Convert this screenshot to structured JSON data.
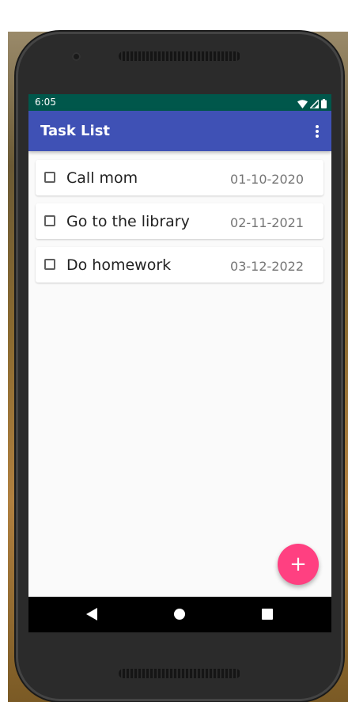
{
  "status_bar": {
    "time": "6:05",
    "icons": [
      "wifi-icon",
      "signal-icon",
      "battery-icon"
    ]
  },
  "app_bar": {
    "title": "Task List",
    "menu_icon": "more-vert-icon"
  },
  "tasks": [
    {
      "title": "Call mom",
      "date": "01-10-2020",
      "checked": false
    },
    {
      "title": "Go to the library",
      "date": "02-11-2021",
      "checked": false
    },
    {
      "title": "Do homework",
      "date": "03-12-2022",
      "checked": false
    }
  ],
  "fab": {
    "label": "+",
    "icon": "add-icon"
  },
  "nav_bar": {
    "buttons": [
      "back-icon",
      "home-icon",
      "recents-icon"
    ]
  },
  "colors": {
    "status_bar": "#00574b",
    "app_bar": "#3f51b5",
    "fab": "#ff4081",
    "background": "#fafafa"
  }
}
